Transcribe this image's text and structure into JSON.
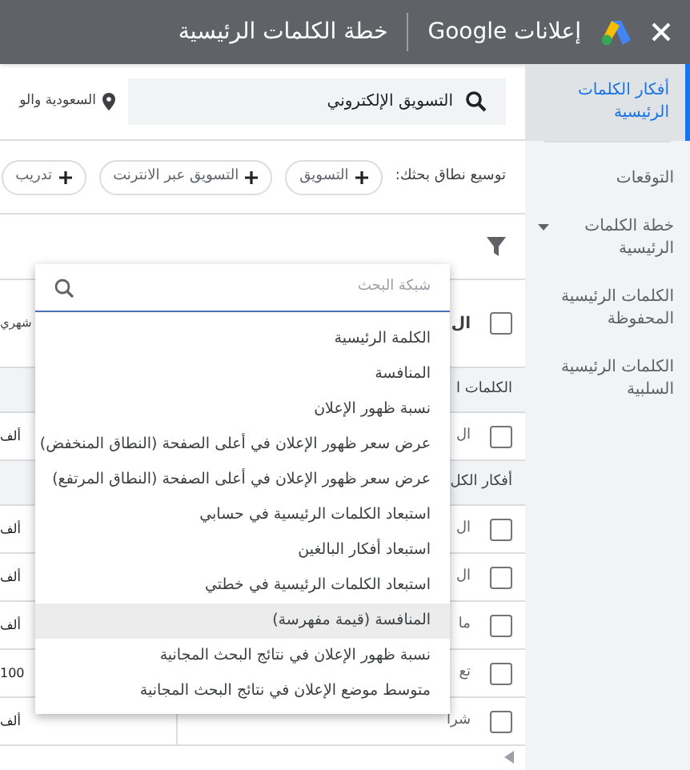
{
  "header": {
    "brand": "إعلانات Google",
    "title": "خطة الكلمات الرئيسية"
  },
  "sidebar": {
    "items": [
      {
        "label": "أفكار الكلمات الرئيسية",
        "selected": true
      },
      {
        "label": "التوقعات",
        "selected": false
      },
      {
        "label": "خطة الكلمات الرئيسية",
        "selected": false,
        "expanded": true
      },
      {
        "label": "الكلمات الرئيسية المحفوظة",
        "selected": false
      },
      {
        "label": "الكلمات الرئيسية السلبية",
        "selected": false
      }
    ]
  },
  "search": {
    "value": "التسويق الإلكتروني",
    "location": "السعودية والو"
  },
  "broaden": {
    "label": "توسيع نطاق بحثك:",
    "chips": [
      "التسويق",
      "التسويق عبر الانترنت",
      "تدريب"
    ]
  },
  "table": {
    "header": {
      "keyword": "ال",
      "column_2": "شهري",
      "checked": false
    },
    "rows": [
      {
        "kind": "section",
        "keyword": "الكلمات ا"
      },
      {
        "kind": "row",
        "keyword": "ال",
        "column_2": "ألف",
        "checked": false
      },
      {
        "kind": "section",
        "keyword": "أفكار الكل"
      },
      {
        "kind": "row",
        "keyword": "ال",
        "column_2": "ألف",
        "checked": false
      },
      {
        "kind": "row",
        "keyword": "ال",
        "column_2": "ألف",
        "checked": false
      },
      {
        "kind": "row",
        "keyword": "ما",
        "column_2": "ألف",
        "checked": false
      },
      {
        "kind": "row",
        "keyword": "تع",
        "column_2": "100",
        "checked": false
      },
      {
        "kind": "row",
        "keyword": "شرا",
        "column_2": "ألف",
        "checked": false
      }
    ]
  },
  "column_menu": {
    "placeholder": "شبكة البحث",
    "items": [
      {
        "label": "الكلمة الرئيسية",
        "selected": false
      },
      {
        "label": "المنافسة",
        "selected": false
      },
      {
        "label": "نسبة ظهور الإعلان",
        "selected": false
      },
      {
        "label": "عرض سعر ظهور الإعلان في أعلى الصفحة (النطاق المنخفض)",
        "selected": false
      },
      {
        "label": "عرض سعر ظهور الإعلان في أعلى الصفحة (النطاق المرتفع)",
        "selected": false
      },
      {
        "label": "استبعاد الكلمات الرئيسية في حسابي",
        "selected": false
      },
      {
        "label": "استبعاد أفكار البالغين",
        "selected": false
      },
      {
        "label": "استبعاد الكلمات الرئيسية في خطتي",
        "selected": false
      },
      {
        "label": "المنافسة (قيمة مفهرسة)",
        "selected": true
      },
      {
        "label": "نسبة ظهور الإعلان في نتائج البحث المجانية",
        "selected": false
      },
      {
        "label": "متوسط موضع الإعلان في نتائج البحث المجانية",
        "selected": false
      }
    ]
  }
}
